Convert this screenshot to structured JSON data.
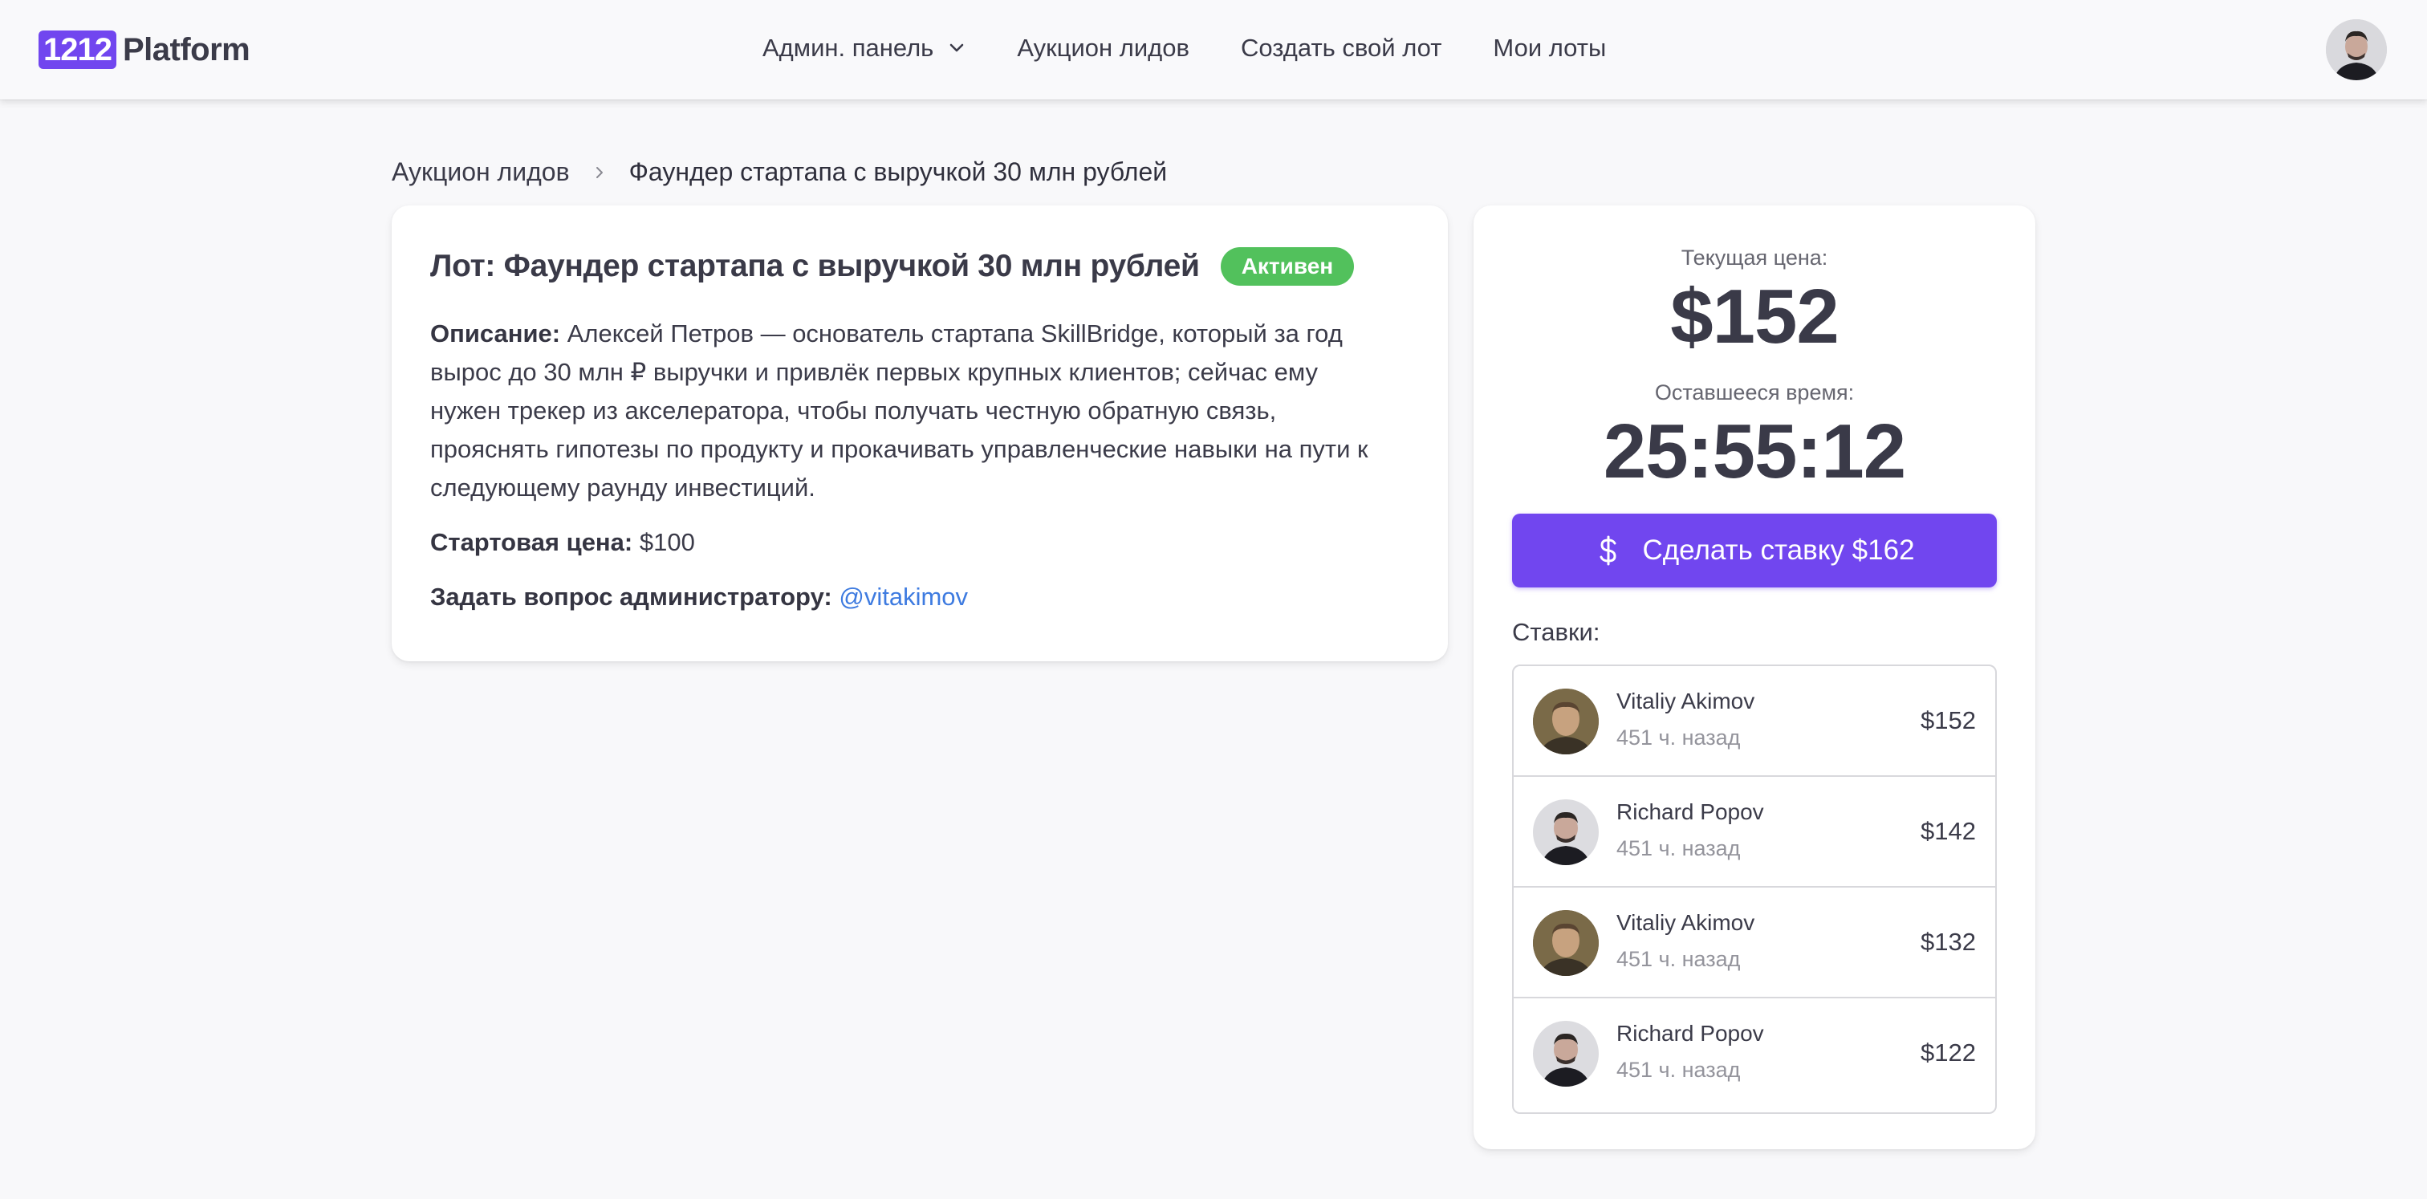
{
  "brand": {
    "box": "1212",
    "text": "Platform",
    "accent": "#7146ef"
  },
  "nav": {
    "items": [
      {
        "label": "Админ. панель",
        "has_dropdown": true
      },
      {
        "label": "Аукцион лидов"
      },
      {
        "label": "Создать свой лот"
      },
      {
        "label": "Мои лоты"
      }
    ]
  },
  "breadcrumb": {
    "root": "Аукцион лидов",
    "current": "Фаундер стартапа с выручкой 30 млн рублей"
  },
  "lot": {
    "title": "Лот: Фаундер стартапа с выручкой 30 млн рублей",
    "status": "Активен",
    "status_color": "#52c15c",
    "description_label": "Описание:",
    "description": "Алексей Петров — основатель стартапа SkillBridge, который за год вырос до 30 млн ₽ выручки и привлёк первых крупных клиентов; сейчас ему нужен трекер из акселератора, чтобы получать честную обратную связь, прояснять гипотезы по продукту и прокачивать управленческие навыки на пути к следующему раунду инвестиций.",
    "start_price_label": "Стартовая цена:",
    "start_price": "$100",
    "ask_label": "Задать вопрос администратору:",
    "ask_link": "@vitakimov"
  },
  "bid_panel": {
    "current_price_label": "Текущая цена:",
    "current_price": "$152",
    "time_left_label": "Оставшееся время:",
    "time_left": "25:55:12",
    "bid_button": "Сделать ставку $162",
    "bids_label": "Ставки:",
    "bids": [
      {
        "name": "Vitaliy Akimov",
        "time": "451 ч. назад",
        "amount": "$152",
        "avatar": "vitaliy"
      },
      {
        "name": "Richard Popov",
        "time": "451 ч. назад",
        "amount": "$142",
        "avatar": "richard"
      },
      {
        "name": "Vitaliy Akimov",
        "time": "451 ч. назад",
        "amount": "$132",
        "avatar": "vitaliy"
      },
      {
        "name": "Richard Popov",
        "time": "451 ч. назад",
        "amount": "$122",
        "avatar": "richard"
      }
    ]
  }
}
